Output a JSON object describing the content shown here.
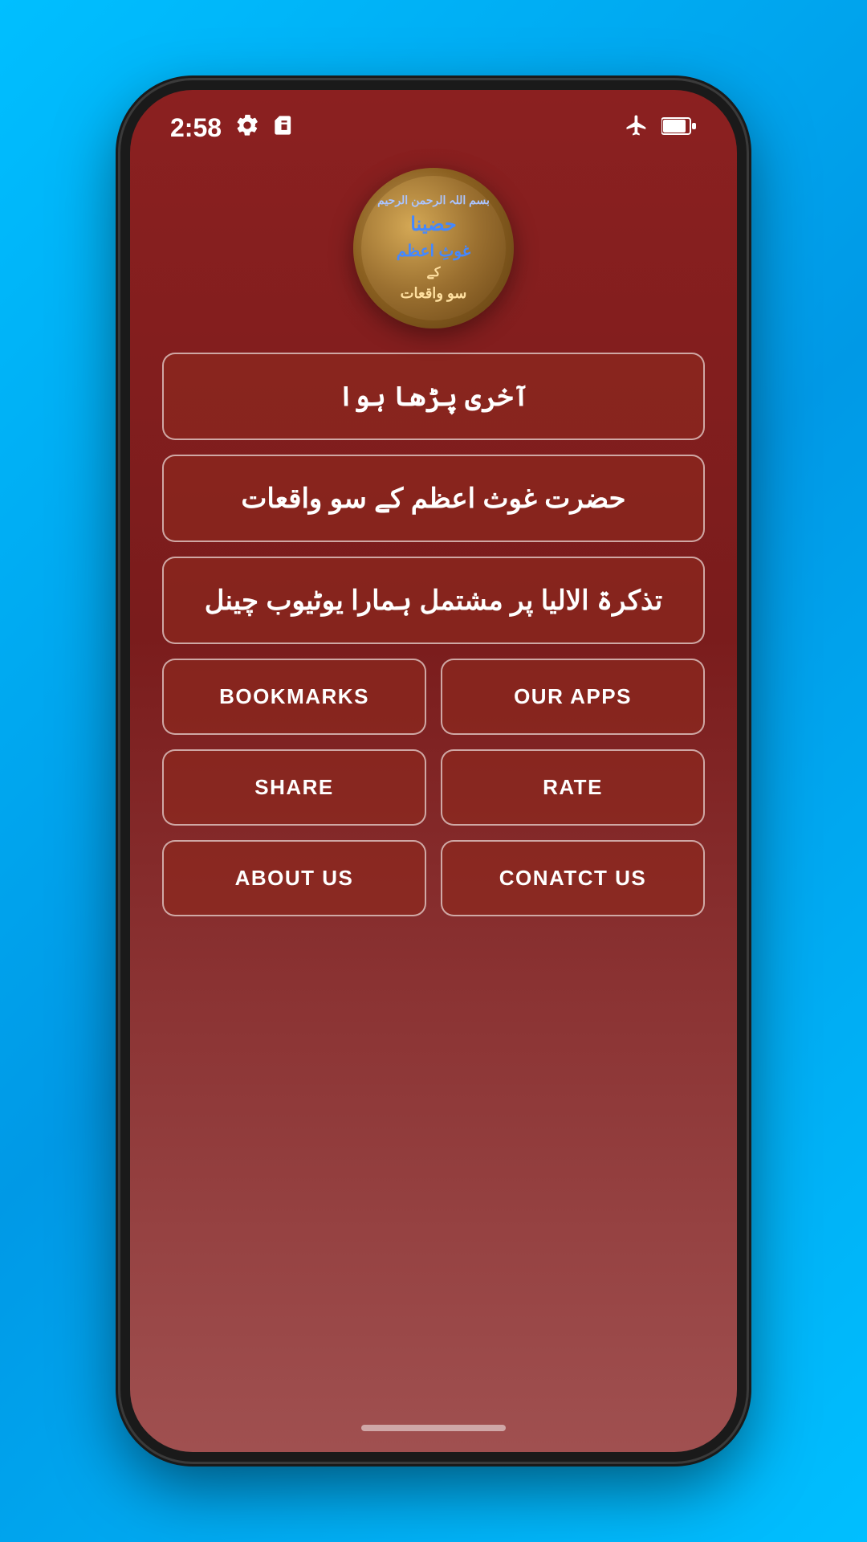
{
  "statusBar": {
    "time": "2:58",
    "icons": [
      "settings",
      "sim",
      "airplane",
      "battery"
    ]
  },
  "logo": {
    "line1": "حضینا غوث",
    "line2": "اعظم",
    "line3": "کے",
    "line4": "سو واقعات"
  },
  "buttons": {
    "lastRead": "آخری پڑھا ہوا",
    "hazratGhous": "حضرت غوث اعظم کے سو واقعات",
    "tazkirah": "تذکرۃ الالیا پر مشتمل ہمارا یوٹیوب چینل",
    "bookmarks": "BOOKMARKS",
    "ourApps": "OUR APPS",
    "share": "SHARE",
    "rate": "RATE",
    "aboutUs": "ABOUT US",
    "contactUs": "CONATCT US"
  }
}
